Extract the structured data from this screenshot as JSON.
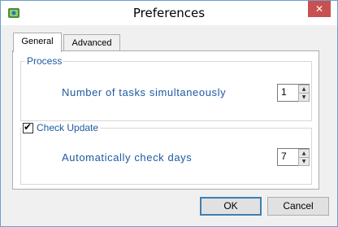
{
  "window": {
    "title": "Preferences",
    "close_glyph": "✕",
    "app_icon": "preferences-app-icon"
  },
  "tabs": [
    {
      "label": "General",
      "active": true
    },
    {
      "label": "Advanced",
      "active": false
    }
  ],
  "process_group": {
    "legend": "Process",
    "tasks_label": "Number of tasks simultaneously",
    "tasks_value": "1"
  },
  "check_update_group": {
    "legend": "Check Update",
    "checked": true,
    "days_label": "Automatically check days",
    "days_value": "7"
  },
  "buttons": {
    "ok": "OK",
    "cancel": "Cancel"
  },
  "colors": {
    "accent_text": "#1e5aa0",
    "close_button": "#c75050",
    "window_border": "#6c9fd3"
  }
}
